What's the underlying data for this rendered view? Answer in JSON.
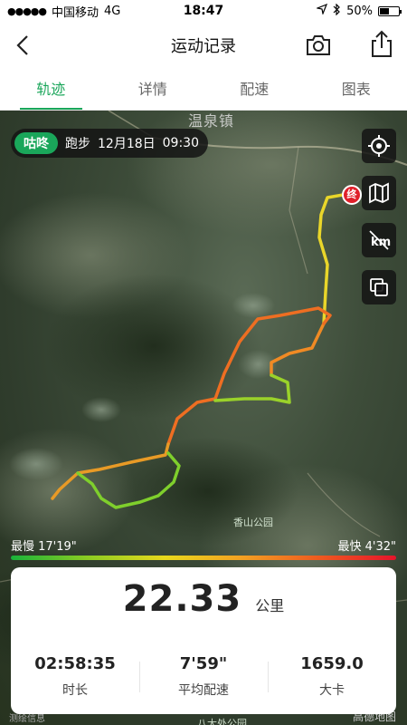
{
  "status_bar": {
    "carrier": "中国移动",
    "network": "4G",
    "time": "18:47",
    "battery": "50%",
    "battery_level": 0.5
  },
  "nav": {
    "title": "运动记录",
    "icons": [
      "back-icon",
      "camera-icon",
      "share-icon"
    ]
  },
  "tabs": [
    {
      "label": "轨迹",
      "active": true
    },
    {
      "label": "详情",
      "active": false
    },
    {
      "label": "配速",
      "active": false
    },
    {
      "label": "图表",
      "active": false
    }
  ],
  "map": {
    "town_label": "温泉镇",
    "park_label": "香山公园",
    "bottom_place_label": "八大处公园",
    "attribution_left": "测绘信息",
    "attribution_right": "高德地图",
    "end_marker": "终",
    "controls": [
      "locate-icon",
      "map-layer-icon",
      "km-toggle-icon",
      "copy-icon"
    ]
  },
  "activity": {
    "brand": "咕咚",
    "sport": "跑步",
    "date": "12月18日",
    "time": "09:30"
  },
  "pace_legend": {
    "slowest_label": "最慢 17'19\"",
    "fastest_label": "最快 4'32\""
  },
  "stats": {
    "distance_value": "22.33",
    "distance_unit": "公里",
    "duration_value": "02:58:35",
    "duration_label": "时长",
    "pace_value": "7'59\"",
    "pace_label": "平均配速",
    "calories_value": "1659.0",
    "calories_label": "大卡"
  },
  "colors": {
    "accent": "#1aa65a",
    "end_marker": "#e0202a"
  }
}
